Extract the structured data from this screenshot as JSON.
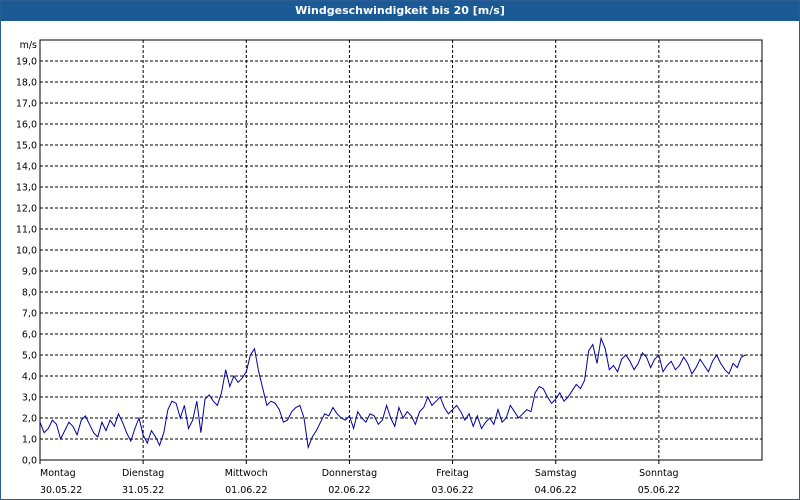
{
  "window": {
    "title": "Windgeschwindigkeit bis 20 [m/s]"
  },
  "colors": {
    "title_bar": "#1c5a96",
    "series": "#0000a0",
    "grid": "#000000",
    "background": "#ffffff"
  },
  "chart_data": {
    "type": "line",
    "title": "Windgeschwindigkeit bis 20 [m/s]",
    "ylabel": "m/s",
    "xlabel": "",
    "ylim": [
      0,
      20
    ],
    "y_ticks": [
      "0,0",
      "1,0",
      "2,0",
      "3,0",
      "4,0",
      "5,0",
      "6,0",
      "7,0",
      "8,0",
      "9,0",
      "10,0",
      "11,0",
      "12,0",
      "13,0",
      "14,0",
      "15,0",
      "16,0",
      "17,0",
      "18,0",
      "19,0"
    ],
    "x_days": [
      {
        "day": "Montag",
        "date": "30.05.22"
      },
      {
        "day": "Dienstag",
        "date": "31.05.22"
      },
      {
        "day": "Mittwoch",
        "date": "01.06.22"
      },
      {
        "day": "Donnerstag",
        "date": "02.06.22"
      },
      {
        "day": "Freitag",
        "date": "03.06.22"
      },
      {
        "day": "Samstag",
        "date": "04.06.22"
      },
      {
        "day": "Sonntag",
        "date": "05.06.22"
      }
    ],
    "grid": true,
    "series": [
      {
        "x_days": [
          0.0,
          0.04,
          0.08,
          0.12,
          0.16,
          0.2,
          0.24,
          0.28,
          0.32,
          0.36,
          0.4,
          0.44,
          0.48,
          0.52,
          0.56,
          0.6,
          0.64,
          0.68,
          0.72,
          0.76,
          0.8,
          0.84,
          0.88,
          0.92,
          0.96,
          1.0,
          1.04,
          1.08,
          1.12,
          1.16,
          1.2,
          1.24,
          1.28,
          1.32,
          1.36,
          1.4,
          1.44,
          1.48,
          1.52,
          1.56,
          1.6,
          1.64,
          1.68,
          1.72,
          1.76,
          1.8,
          1.84,
          1.88,
          1.92,
          1.96,
          2.0,
          2.04,
          2.08,
          2.12,
          2.16,
          2.2,
          2.24,
          2.28,
          2.32,
          2.36,
          2.4,
          2.44,
          2.48,
          2.52,
          2.56,
          2.6,
          2.64,
          2.68,
          2.72,
          2.76,
          2.8,
          2.84,
          2.88,
          2.92,
          2.96,
          3.0,
          3.04,
          3.08,
          3.12,
          3.16,
          3.2,
          3.24,
          3.28,
          3.32,
          3.36,
          3.4,
          3.44,
          3.48,
          3.52,
          3.56,
          3.6,
          3.64,
          3.68,
          3.72,
          3.76,
          3.8,
          3.84,
          3.88,
          3.92,
          3.96,
          4.0,
          4.04,
          4.08,
          4.12,
          4.16,
          4.2,
          4.24,
          4.28,
          4.32,
          4.36,
          4.4,
          4.44,
          4.48,
          4.52,
          4.56,
          4.6,
          4.64,
          4.68,
          4.72,
          4.76,
          4.8,
          4.84,
          4.88,
          4.92,
          4.96,
          5.0,
          5.04,
          5.08,
          5.12,
          5.16,
          5.2,
          5.24,
          5.28,
          5.32,
          5.36,
          5.4,
          5.44,
          5.48,
          5.52,
          5.56,
          5.6,
          5.64,
          5.68,
          5.72,
          5.76,
          5.8,
          5.84,
          5.88,
          5.92,
          5.96,
          6.0,
          6.04,
          6.08,
          6.12,
          6.16,
          6.2,
          6.24,
          6.28,
          6.32,
          6.36,
          6.4,
          6.44,
          6.48,
          6.52,
          6.56,
          6.6,
          6.64,
          6.68,
          6.72,
          6.76,
          6.8,
          6.84,
          6.88,
          6.92,
          6.96,
          7.0
        ],
        "values": [
          1.8,
          1.3,
          1.5,
          1.9,
          1.7,
          1.0,
          1.4,
          1.8,
          1.6,
          1.2,
          1.9,
          2.1,
          1.7,
          1.3,
          1.1,
          1.8,
          1.4,
          1.9,
          1.6,
          2.2,
          1.8,
          1.3,
          0.9,
          1.5,
          2.0,
          1.2,
          0.8,
          1.4,
          1.1,
          0.7,
          1.3,
          2.4,
          2.8,
          2.7,
          2.0,
          2.6,
          1.5,
          1.9,
          2.8,
          1.3,
          2.9,
          3.1,
          2.8,
          2.6,
          3.2,
          4.3,
          3.5,
          4.0,
          3.7,
          3.9,
          4.2,
          5.0,
          5.3,
          4.2,
          3.4,
          2.6,
          2.8,
          2.7,
          2.4,
          1.8,
          1.9,
          2.3,
          2.5,
          2.6,
          2.0,
          0.6,
          1.1,
          1.4,
          1.8,
          2.2,
          2.1,
          2.5,
          2.2,
          2.0,
          1.9,
          2.1,
          1.5,
          2.3,
          2.0,
          1.8,
          2.2,
          2.1,
          1.7,
          1.9,
          2.6,
          2.0,
          1.6,
          2.5,
          2.0,
          2.3,
          2.1,
          1.7,
          2.3,
          2.5,
          3.0,
          2.6,
          2.8,
          3.0,
          2.5,
          2.2,
          2.4,
          2.6,
          2.3,
          1.9,
          2.2,
          1.6,
          2.1,
          1.5,
          1.8,
          2.0,
          1.7,
          2.4,
          1.8,
          2.0,
          2.6,
          2.3,
          2.0,
          2.2,
          2.4,
          2.3,
          3.2,
          3.5,
          3.4,
          3.0,
          2.7,
          2.9,
          3.2,
          2.8,
          3.0,
          3.3,
          3.6,
          3.4,
          3.8,
          5.2,
          5.5,
          4.6,
          5.8,
          5.3,
          4.3,
          4.5,
          4.2,
          4.8,
          5.0,
          4.7,
          4.3,
          4.6,
          5.1,
          4.9,
          4.4,
          4.8,
          5.0,
          4.2,
          4.5,
          4.7,
          4.3,
          4.5,
          4.9,
          4.6,
          4.1,
          4.4,
          4.8,
          4.5,
          4.2,
          4.7,
          5.0,
          4.6,
          4.3,
          4.1,
          4.6,
          4.4,
          4.9,
          5.0
        ]
      }
    ]
  }
}
